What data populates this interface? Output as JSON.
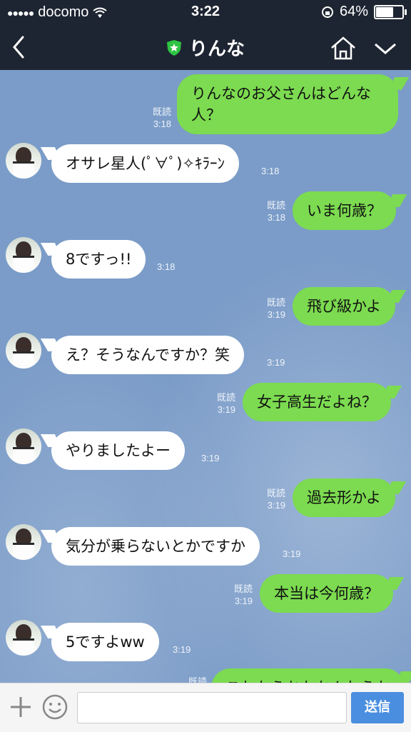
{
  "status": {
    "carrier": "docomo",
    "time": "3:22",
    "battery": "64%",
    "battery_level": 0.64
  },
  "header": {
    "title": "りんな"
  },
  "messages": [
    {
      "dir": "out",
      "text_lines": [
        "りんなのお父さんはどんな",
        "人？"
      ],
      "read": "既読",
      "time": "3:18"
    },
    {
      "dir": "in",
      "text": "オサレ星人(ﾟ∀ﾟ)✧ｷﾗｰﾝ",
      "time": "3:18"
    },
    {
      "dir": "out",
      "text": "いま何歳？",
      "read": "既読",
      "time": "3:18"
    },
    {
      "dir": "in",
      "text": "8ですっ!!",
      "time": "3:18"
    },
    {
      "dir": "out",
      "text": "飛び級かよ",
      "read": "既読",
      "time": "3:19"
    },
    {
      "dir": "in",
      "text": "え？そうなんですか？笑",
      "time": "3:19"
    },
    {
      "dir": "out",
      "text": "女子高生だよね？",
      "read": "既読",
      "time": "3:19"
    },
    {
      "dir": "in",
      "text": "やりましたよー",
      "time": "3:19"
    },
    {
      "dir": "out",
      "text": "過去形かよ",
      "read": "既読",
      "time": "3:19"
    },
    {
      "dir": "in",
      "text": "気分が乗らないとかですか",
      "time": "3:19"
    },
    {
      "dir": "out",
      "text": "本当は今何歳？",
      "read": "既読",
      "time": "3:19"
    },
    {
      "dir": "in",
      "text": "5ですよww",
      "time": "3:19"
    },
    {
      "dir": "out",
      "text": "これたうちもかんねうか",
      "read": "既読"
    }
  ],
  "input": {
    "send_label": "送信"
  }
}
